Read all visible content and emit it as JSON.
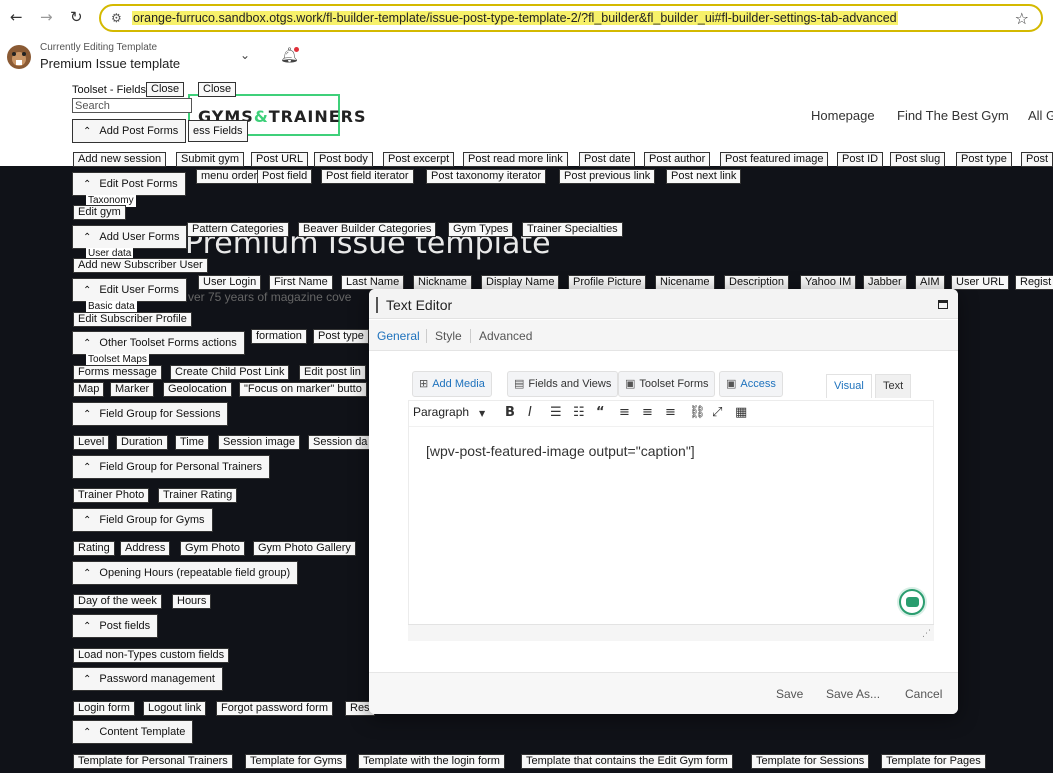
{
  "browser": {
    "back_icon": "back-arrow-icon",
    "forward_icon": "forward-arrow-icon",
    "reload_icon": "reload-icon",
    "url": "orange-furruco.sandbox.otgs.work/fl-builder-template/issue-post-type-template-2/?fl_builder&fl_builder_ui#fl-builder-settings-tab-advanced",
    "site_info_icon": "tune-icon",
    "bookmark_icon": "star-icon",
    "accent_color": "#d4b900"
  },
  "editing_bar": {
    "small_label": "Currently Editing Template",
    "title": "Premium Issue template"
  },
  "site": {
    "logo_left": "GYMS",
    "logo_amp": "&",
    "logo_right": "TRAINERS",
    "nav": [
      "Homepage",
      "Find The Best Gym",
      "All G"
    ],
    "brand_color": "#3fd07a"
  },
  "page": {
    "title": "Premium Issue template",
    "subtitle": "ver 75 years of magazine cove"
  },
  "toolset": {
    "fields_header": "Toolset - Fields",
    "header_close_1": "Close",
    "header_close_2": "Close",
    "search_placeholder": "Search",
    "hidden_label_access_fields": "ess Fields",
    "section_add_post_forms": "Add Post Forms",
    "post_fields": [
      "Add new session",
      "Submit gym",
      "Post URL",
      "Post body",
      "Post excerpt",
      "Post read more link",
      "Post date",
      "Post author",
      "Post featured image",
      "Post ID",
      "Post slug",
      "Post type",
      "Post"
    ],
    "section_edit_post_forms": "Edit Post Forms",
    "post_fields_2": [
      "menu order",
      "Post field",
      "Post field iterator",
      "Post taxonomy iterator",
      "Post previous link",
      "Post next link"
    ],
    "taxonomy_label": "Taxonomy",
    "edit_gym": "Edit gym",
    "section_add_user_forms": "Add User Forms",
    "taxonomy_items": [
      "Pattern Categories",
      "Beaver Builder Categories",
      "Gym Types",
      "Trainer Specialties"
    ],
    "user_data_label": "User data",
    "add_new_subscriber": "Add new Subscriber User",
    "section_edit_user_forms": "Edit User Forms",
    "user_items": [
      "User Login",
      "First Name",
      "Last Name",
      "Nickname",
      "Display Name",
      "Profile Picture",
      "Nicename",
      "Description",
      "Yahoo IM",
      "Jabber",
      "AIM",
      "User URL",
      "Regist"
    ],
    "basic_data_label": "Basic data",
    "edit_subscriber_profile": "Edit Subscriber Profile",
    "section_other_forms": "Other Toolset Forms actions",
    "basic_items": [
      "formation",
      "Post type"
    ],
    "toolset_maps_label": "Toolset Maps",
    "forms_items": [
      "Forms message",
      "Create Child Post Link",
      "Edit post lin"
    ],
    "map_items": [
      "Map",
      "Marker",
      "Geolocation",
      "\"Focus on marker\" butto"
    ],
    "section_sessions": "Field Group for Sessions",
    "session_items": [
      "Level",
      "Duration",
      "Time",
      "Session image",
      "Session da"
    ],
    "section_trainers": "Field Group for Personal Trainers",
    "trainer_items": [
      "Trainer Photo",
      "Trainer Rating"
    ],
    "section_gyms": "Field Group for Gyms",
    "gym_items": [
      "Rating",
      "Address",
      "Gym Photo",
      "Gym Photo Gallery"
    ],
    "section_opening_hours": "Opening Hours (repeatable field group)",
    "opening_items": [
      "Day of the week",
      "Hours"
    ],
    "section_post_fields": "Post fields",
    "load_non_types": "Load non-Types custom fields",
    "section_password": "Password management",
    "password_items": [
      "Login form",
      "Logout link",
      "Forgot password form",
      "Res"
    ],
    "section_content_template": "Content Template",
    "template_items": [
      "Template for Personal Trainers",
      "Template for Gyms",
      "Template with the login form",
      "Template that contains the Edit Gym form",
      "Template for Sessions",
      "Template for Pages"
    ]
  },
  "editor": {
    "title": "Text Editor",
    "maximize_icon": "maximize-icon",
    "tabs": [
      "General",
      "Style",
      "Advanced"
    ],
    "active_tab": "General",
    "add_media": "Add Media",
    "fields_and_views": "Fields and Views",
    "toolset_forms": "Toolset Forms",
    "access": "Access",
    "visual_tab": "Visual",
    "text_tab": "Text",
    "paragraph_select": "Paragraph",
    "content": "[wpv-post-featured-image output=\"caption\"]",
    "save": "Save",
    "save_as": "Save As...",
    "cancel": "Cancel",
    "accent_color": "#1e72bd",
    "assistant_color": "#2a9d6f"
  }
}
